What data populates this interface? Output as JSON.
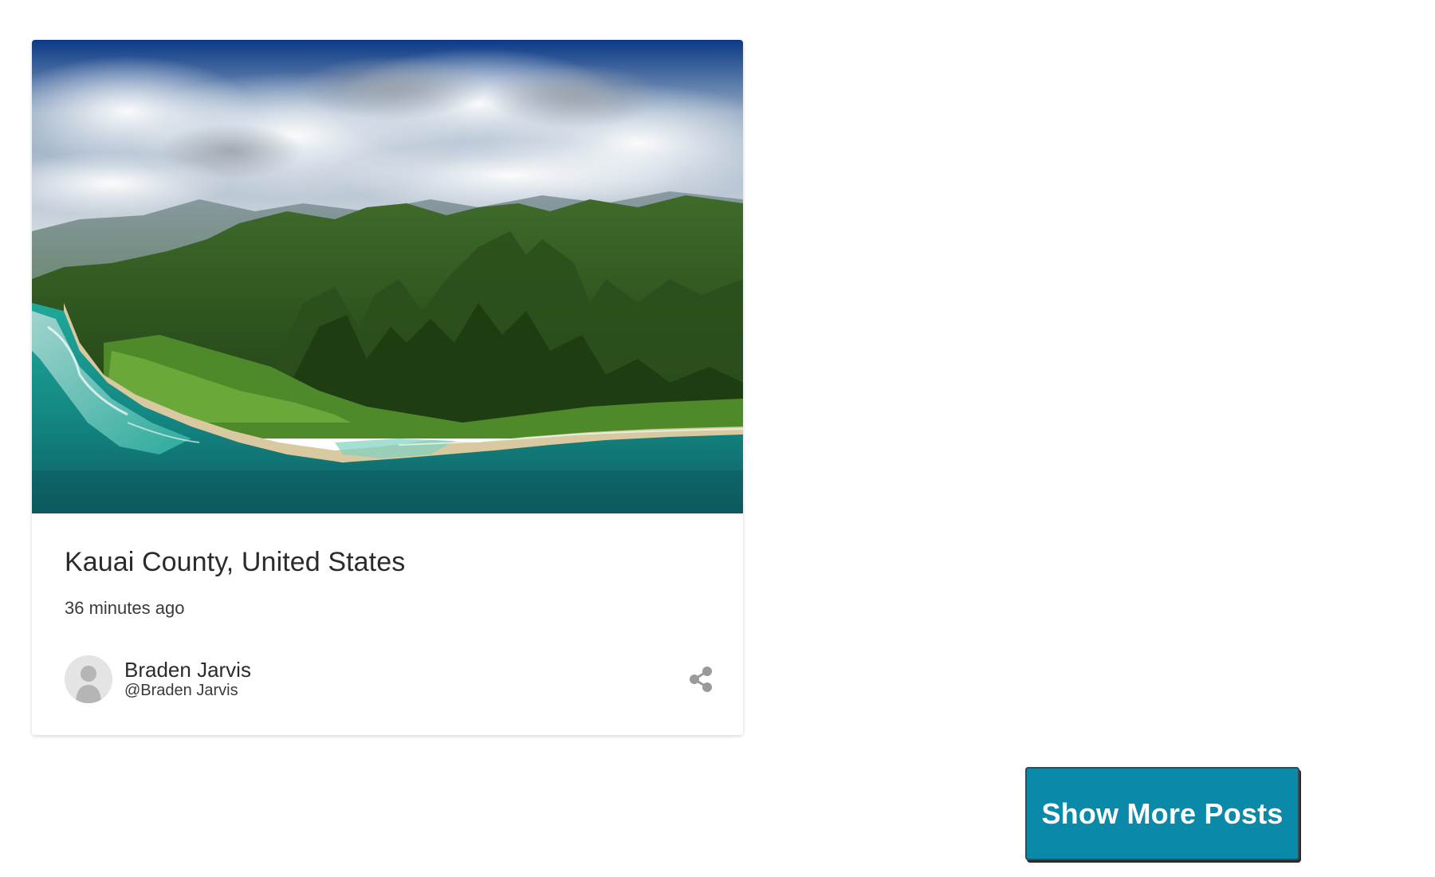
{
  "post": {
    "title": "Kauai County, United States",
    "time": "36 minutes ago",
    "author": {
      "name": "Braden Jarvis",
      "handle": "@Braden Jarvis"
    },
    "image_icon": "landscape-photo",
    "avatar_icon": "user-silhouette-icon",
    "share_icon": "share-icon"
  },
  "actions": {
    "show_more_label": "Show More Posts"
  },
  "colors": {
    "button_bg": "#0a89a8",
    "button_text": "#ffffff",
    "share_icon": "#9a9a9a"
  }
}
